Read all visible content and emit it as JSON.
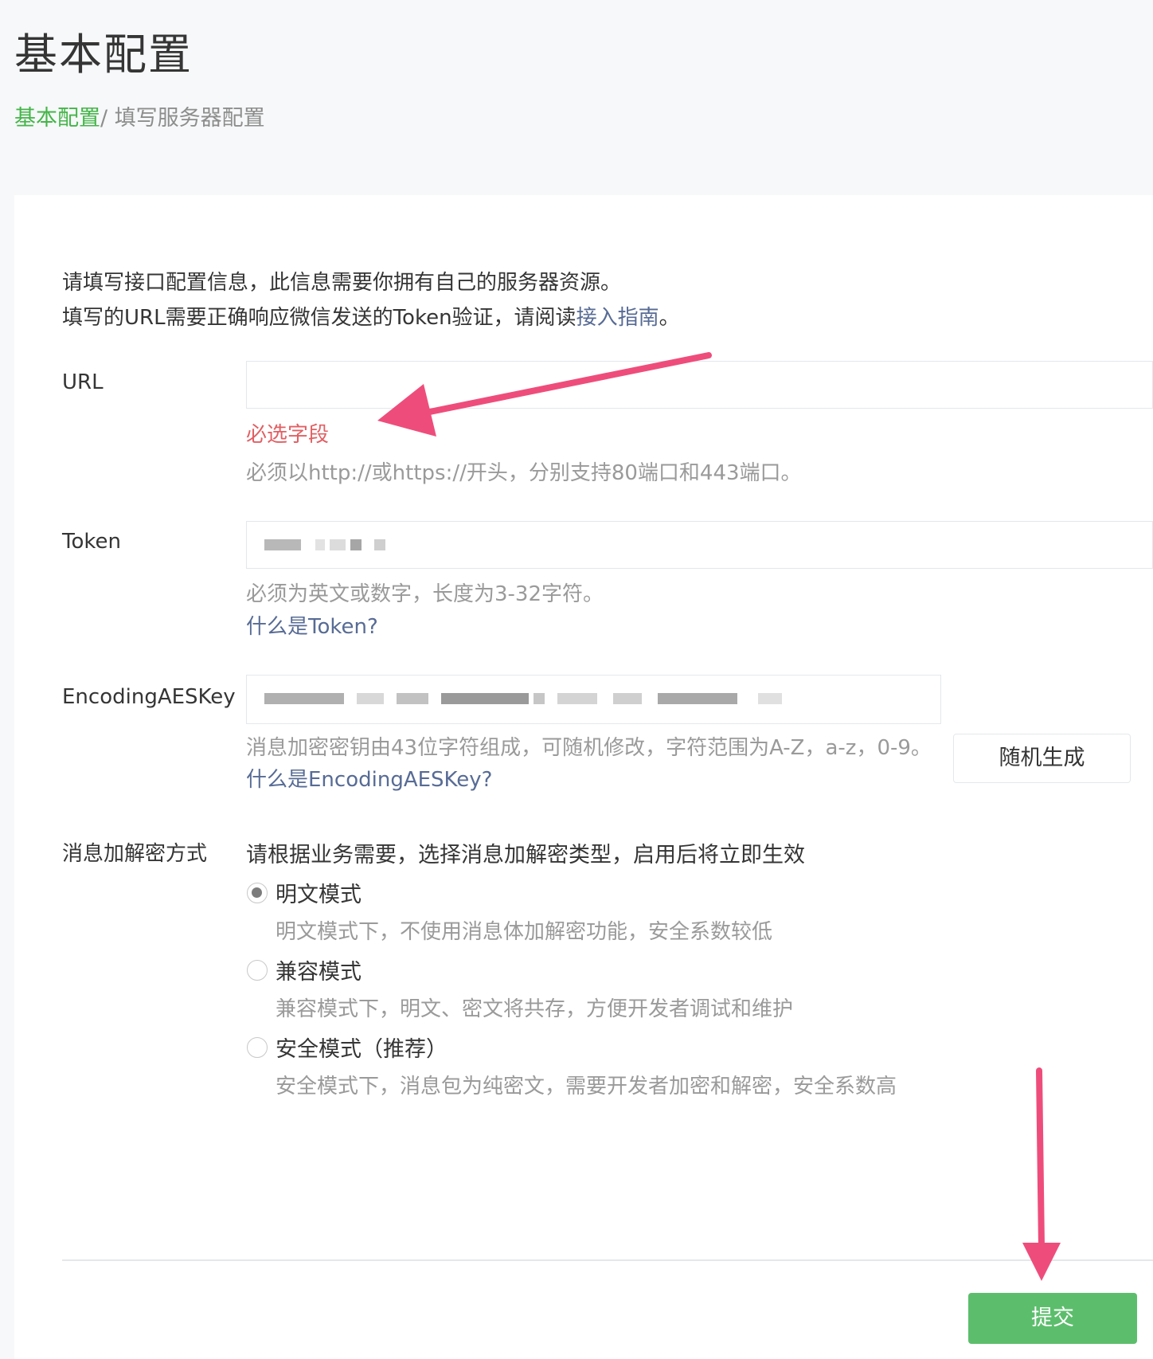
{
  "page_title": "基本配置",
  "breadcrumb": {
    "link": "基本配置",
    "separator": "/ ",
    "current": "填写服务器配置"
  },
  "intro": {
    "line1": "请填写接口配置信息，此信息需要你拥有自己的服务器资源。",
    "line2_prefix": "填写的URL需要正确响应微信发送的Token验证，请阅读",
    "line2_link": "接入指南",
    "line2_suffix": "。"
  },
  "url_field": {
    "label": "URL",
    "value": "",
    "error": "必选字段",
    "tip": "必须以http://或https://开头，分别支持80端口和443端口。"
  },
  "token_field": {
    "label": "Token",
    "value": "(blurred)",
    "tip": "必须为英文或数字，长度为3-32字符。",
    "help_link": "什么是Token?"
  },
  "aeskey_field": {
    "label": "EncodingAESKey",
    "value": "(blurred)",
    "random_button": "随机生成",
    "tip": "消息加密密钥由43位字符组成，可随机修改，字符范围为A-Z，a-z，0-9。",
    "help_link": "什么是EncodingAESKey?"
  },
  "encryption": {
    "label": "消息加解密方式",
    "description": "请根据业务需要，选择消息加解密类型，启用后将立即生效",
    "options": [
      {
        "label": "明文模式",
        "desc": "明文模式下，不使用消息体加解密功能，安全系数较低",
        "checked": true
      },
      {
        "label": "兼容模式",
        "desc": "兼容模式下，明文、密文将共存，方便开发者调试和维护",
        "checked": false
      },
      {
        "label": "安全模式（推荐）",
        "desc": "安全模式下，消息包为纯密文，需要开发者加密和解密，安全系数高",
        "checked": false
      }
    ]
  },
  "submit_button": "提交",
  "colors": {
    "brand_green": "#44b549",
    "button_green": "#5cbe6c",
    "link_blue": "#576b95",
    "error_red": "#e15f63",
    "annotation_arrow": "#ee4d7b"
  }
}
